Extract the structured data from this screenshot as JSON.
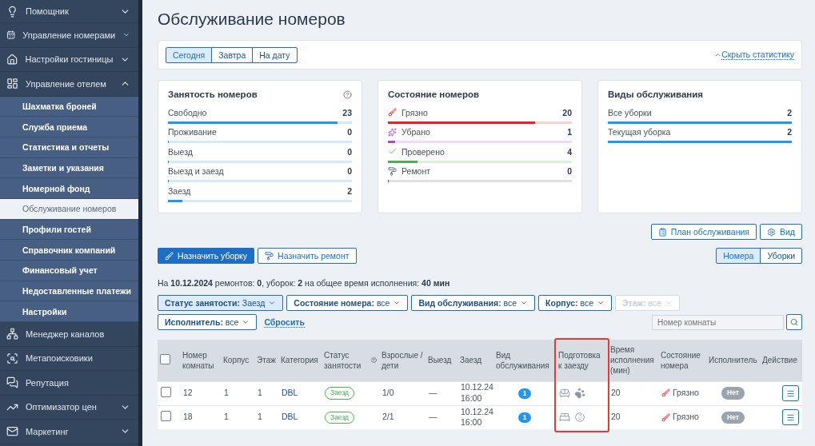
{
  "sidebar": {
    "items": [
      {
        "kind": "group",
        "label": "Помощник",
        "expanded": false
      },
      {
        "kind": "group",
        "label": "Управление номерами",
        "expanded": false
      },
      {
        "kind": "group",
        "label": "Настройки гостиницы",
        "expanded": false
      },
      {
        "kind": "group",
        "label": "Управление отелем",
        "expanded": true,
        "children": [
          {
            "label": "Шахматка броней",
            "selected": false
          },
          {
            "label": "Служба приема",
            "selected": false
          },
          {
            "label": "Статистика и отчеты",
            "selected": false
          },
          {
            "label": "Заметки и указания",
            "selected": false
          },
          {
            "label": "Номерной фонд",
            "selected": false
          },
          {
            "label": "Обслуживание номеров",
            "selected": true
          },
          {
            "label": "Профили гостей",
            "selected": false
          },
          {
            "label": "Справочник компаний",
            "selected": false
          },
          {
            "label": "Финансовый учет",
            "selected": false
          },
          {
            "label": "Недоставленные платежи",
            "selected": false
          },
          {
            "label": "Настройки",
            "selected": false
          }
        ]
      },
      {
        "kind": "link",
        "label": "Менеджер каналов"
      },
      {
        "kind": "link",
        "label": "Метапоисковики"
      },
      {
        "kind": "link",
        "label": "Репутация"
      },
      {
        "kind": "group",
        "label": "Оптимизатор цен",
        "expanded": false
      },
      {
        "kind": "group",
        "label": "Маркетинг",
        "expanded": false
      }
    ]
  },
  "title": "Обслуживание номеров",
  "date_tabs": [
    {
      "label": "Сегодня",
      "selected": true
    },
    {
      "label": "Завтра",
      "selected": false
    },
    {
      "label": "На дату",
      "selected": false
    }
  ],
  "hide_stats_link": "Скрыть статистику",
  "stat_cards": [
    {
      "title": "Занятость номеров",
      "help": true,
      "rows": [
        {
          "label": "Свободно",
          "value": "23",
          "level": 0.92,
          "color": "#2196f3"
        },
        {
          "label": "Проживание",
          "value": "0",
          "level": 0,
          "color": "#2196f3"
        },
        {
          "label": "Выезд",
          "value": "0",
          "level": 0,
          "color": "#2196f3"
        },
        {
          "label": "Выезд и заезд",
          "value": "0",
          "level": 0,
          "color": "#2196f3"
        },
        {
          "label": "Заезд",
          "value": "2",
          "level": 0.08,
          "color": "#2196f3"
        }
      ]
    },
    {
      "title": "Состояние номеров",
      "help": false,
      "rows": [
        {
          "kind": "dirty",
          "label": "Грязно",
          "value": "20",
          "level": 0.8,
          "color": "#e8202a"
        },
        {
          "kind": "cleaned",
          "label": "Убрано",
          "value": "1",
          "level": 0.04,
          "color": "#a64fc4"
        },
        {
          "kind": "inspected",
          "label": "Проверено",
          "value": "4",
          "level": 0.16,
          "color": "#4caf50"
        },
        {
          "kind": "repair",
          "label": "Ремонт",
          "value": "0",
          "level": 0,
          "color": "#555f6b"
        }
      ]
    },
    {
      "title": "Виды обслуживания",
      "help": false,
      "rows": [
        {
          "label": "Все уборки",
          "value": "2",
          "level": 1,
          "color": "#2196f3"
        },
        {
          "label": "Текущая уборка",
          "value": "2",
          "level": 1,
          "color": "#2196f3"
        }
      ]
    }
  ],
  "top_buttons": [
    "План обслуживания",
    "Вид"
  ],
  "action_buttons": [
    {
      "label": "Назначить уборку",
      "primary": true
    },
    {
      "label": "Назначить ремонт",
      "primary": false
    }
  ],
  "view_tabs": [
    {
      "label": "Номера",
      "selected": true
    },
    {
      "label": "Уборки",
      "selected": false
    }
  ],
  "summary": "На **10.12.2024** ремонтов: **0**, уборок: **2** на общее время исполнения: **40 мин**",
  "filters": [
    {
      "text": "**Статус занятости:** Заезд",
      "active": true,
      "disabled": false
    },
    {
      "text": "**Состояние номера:** все",
      "active": false,
      "disabled": false
    },
    {
      "text": "**Вид обслуживания:** все",
      "active": false,
      "disabled": false
    },
    {
      "text": "**Корпус:** все",
      "active": false,
      "disabled": false
    },
    {
      "text": "**Этаж:** все",
      "active": false,
      "disabled": true
    },
    {
      "text": "**Исполнитель:** все",
      "active": false,
      "disabled": false
    }
  ],
  "reset_link": "Сбросить",
  "room_search": {
    "placeholder": "Номер комнаты"
  },
  "table": {
    "select_all_checked": false,
    "columns": [
      {
        "label": "Номер комнаты",
        "highlighted": false
      },
      {
        "label": "Корпус",
        "highlighted": false
      },
      {
        "label": "Этаж",
        "highlighted": false
      },
      {
        "label": "Категория",
        "highlighted": false
      },
      {
        "label": "Статус занятости",
        "highlighted": false,
        "help": true
      },
      {
        "label": "Взрослые / дети",
        "highlighted": false
      },
      {
        "label": "Выезд",
        "highlighted": false
      },
      {
        "label": "Заезд",
        "highlighted": false
      },
      {
        "label": "Вид обслуживания",
        "highlighted": false
      },
      {
        "label": "Подготовка к заезду",
        "highlighted": true
      },
      {
        "label": "Время исполнения (мин)",
        "highlighted": false
      },
      {
        "label": "Состояние номера",
        "highlighted": false
      },
      {
        "label": "Исполнитель",
        "highlighted": false
      },
      {
        "label": "Действие",
        "highlighted": false
      }
    ],
    "rows": [
      {
        "checked": false,
        "room": "12",
        "building": "1",
        "floor": "1",
        "category": "DBL",
        "status": "Заезд",
        "guests": "1/0",
        "departure": "—",
        "arrival": "10.12.24 16:00",
        "service_count": "1",
        "prep": [
          {
            "kind": "extra-bed"
          },
          {
            "kind": "pet"
          }
        ],
        "time": "20",
        "state": "Грязно",
        "executor": "Нет"
      },
      {
        "checked": false,
        "room": "18",
        "building": "1",
        "floor": "1",
        "category": "DBL",
        "status": "Заезд",
        "guests": "2/1",
        "departure": "—",
        "arrival": "10.12.24 16:00",
        "service_count": "1",
        "prep": [
          {
            "kind": "bed"
          },
          {
            "kind": "baby"
          }
        ],
        "time": "20",
        "state": "Грязно",
        "executor": "Нет"
      }
    ]
  }
}
